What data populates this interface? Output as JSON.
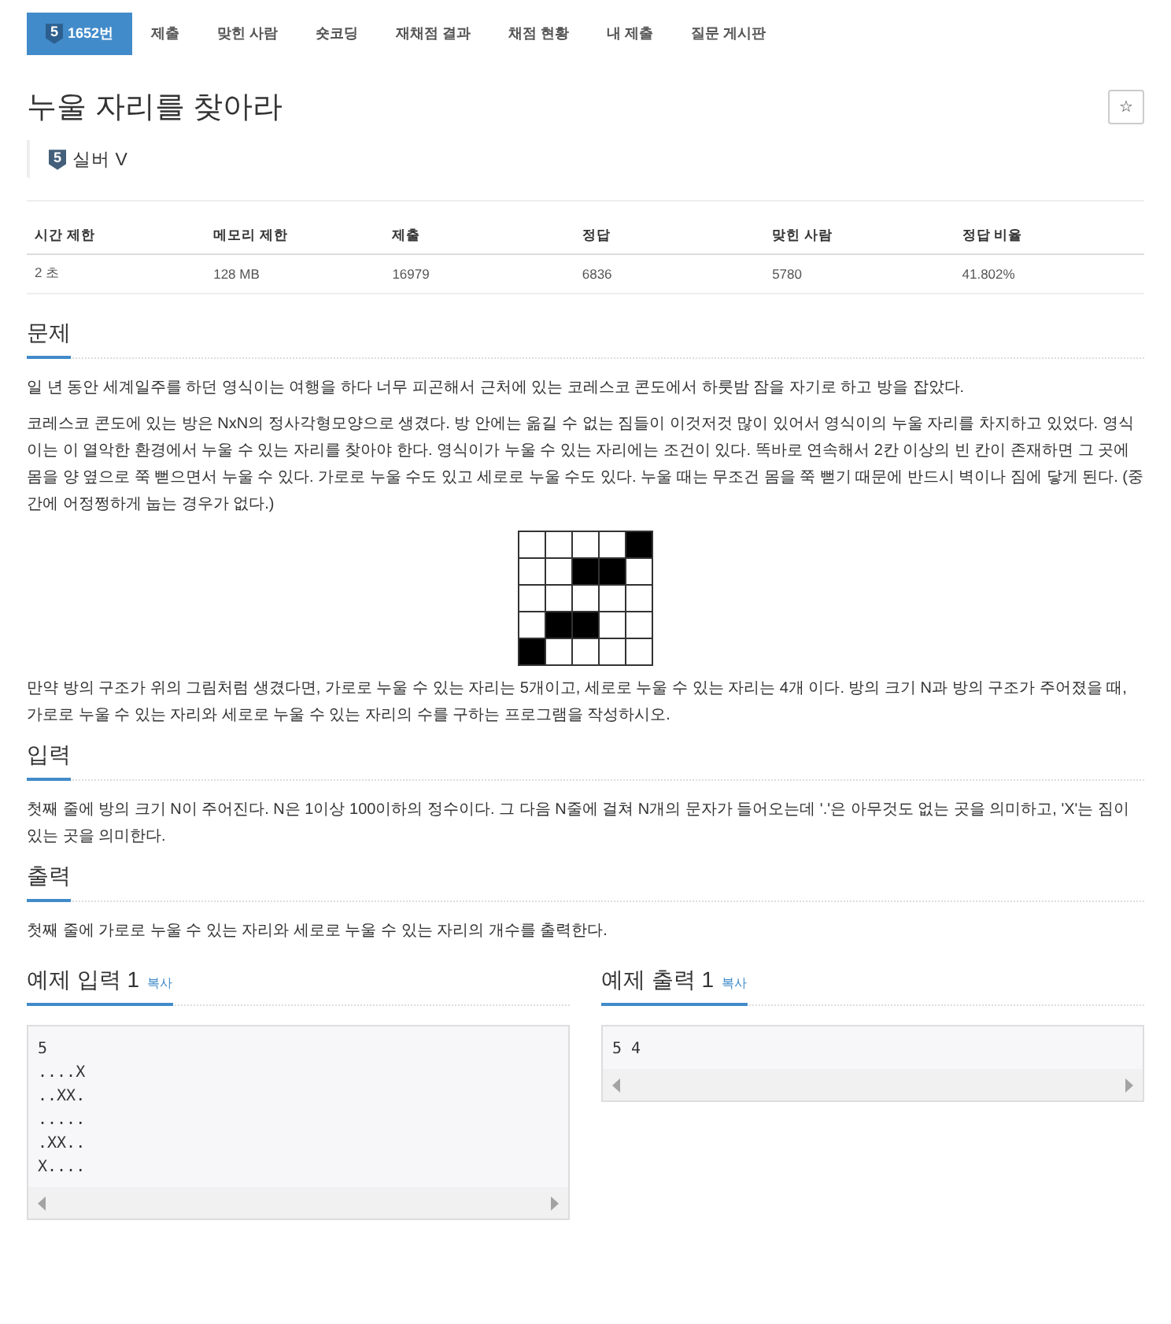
{
  "nav": [
    {
      "label": "1652번",
      "tier": "5",
      "selected": true
    },
    {
      "label": "제출",
      "selected": false
    },
    {
      "label": "맞힌 사람",
      "selected": false
    },
    {
      "label": "숏코딩",
      "selected": false
    },
    {
      "label": "재채점 결과",
      "selected": false
    },
    {
      "label": "채점 현황",
      "selected": false
    },
    {
      "label": "내 제출",
      "selected": false
    },
    {
      "label": "질문 게시판",
      "selected": false
    }
  ],
  "problem": {
    "title": "누울 자리를 찾아라",
    "star": "☆",
    "tier_level": "5",
    "tier_name": "실버 V"
  },
  "info_table": {
    "columns": [
      "시간 제한",
      "메모리 제한",
      "제출",
      "정답",
      "맞힌 사람",
      "정답 비율"
    ],
    "row": [
      "2 초",
      "128 MB",
      "16979",
      "6836",
      "5780",
      "41.802%"
    ]
  },
  "sections": [
    {
      "heading": "문제",
      "blocks": [
        {
          "kind": "text",
          "text": "일 년 동안 세계일주를 하던 영식이는 여행을 하다 너무 피곤해서 근처에 있는 코레스코 콘도에서 하룻밤 잠을 자기로 하고 방을 잡았다."
        },
        {
          "kind": "text",
          "text": "코레스코 콘도에 있는 방은 NxN의 정사각형모양으로 생겼다. 방 안에는 옮길 수 없는 짐들이 이것저것 많이 있어서 영식이의 누울 자리를 차지하고 있었다. 영식이는 이 열악한 환경에서 누울 수 있는 자리를 찾아야 한다. 영식이가 누울 수 있는 자리에는 조건이 있다. 똑바로 연속해서 2칸 이상의 빈 칸이 존재하면 그 곳에 몸을 양 옆으로 쭉 뻗으면서 누울 수 있다. 가로로 누울 수도 있고 세로로 누울 수도 있다. 누울 때는 무조건 몸을 쭉 뻗기 때문에 반드시 벽이나 짐에 닿게 된다. (중간에 어정쩡하게 눕는 경우가 없다.)"
        },
        {
          "kind": "grid"
        },
        {
          "kind": "text",
          "text": "만약 방의 구조가 위의 그림처럼 생겼다면, 가로로 누울 수 있는 자리는 5개이고, 세로로 누울 수 있는 자리는 4개 이다. 방의 크기 N과 방의 구조가 주어졌을 때, 가로로 누울 수 있는 자리와 세로로 누울 수 있는 자리의 수를 구하는 프로그램을 작성하시오."
        }
      ]
    },
    {
      "heading": "입력",
      "blocks": [
        {
          "kind": "text",
          "text": "첫째 줄에 방의 크기 N이 주어진다. N은 1이상 100이하의 정수이다. 그 다음 N줄에 걸쳐 N개의 문자가 들어오는데 '.'은 아무것도 없는 곳을 의미하고, 'X'는 짐이 있는 곳을 의미한다."
        }
      ]
    },
    {
      "heading": "출력",
      "blocks": [
        {
          "kind": "text",
          "text": "첫째 줄에 가로로 누울 수 있는 자리와 세로로 누울 수 있는 자리의 개수를 출력한다."
        }
      ]
    }
  ],
  "samples": [
    {
      "heading": "예제 입력 1",
      "copy": "복사",
      "content": "5\n....X\n..XX.\n.....\n.XX..\nX...."
    },
    {
      "heading": "예제 출력 1",
      "copy": "복사",
      "content": "5 4"
    }
  ]
}
